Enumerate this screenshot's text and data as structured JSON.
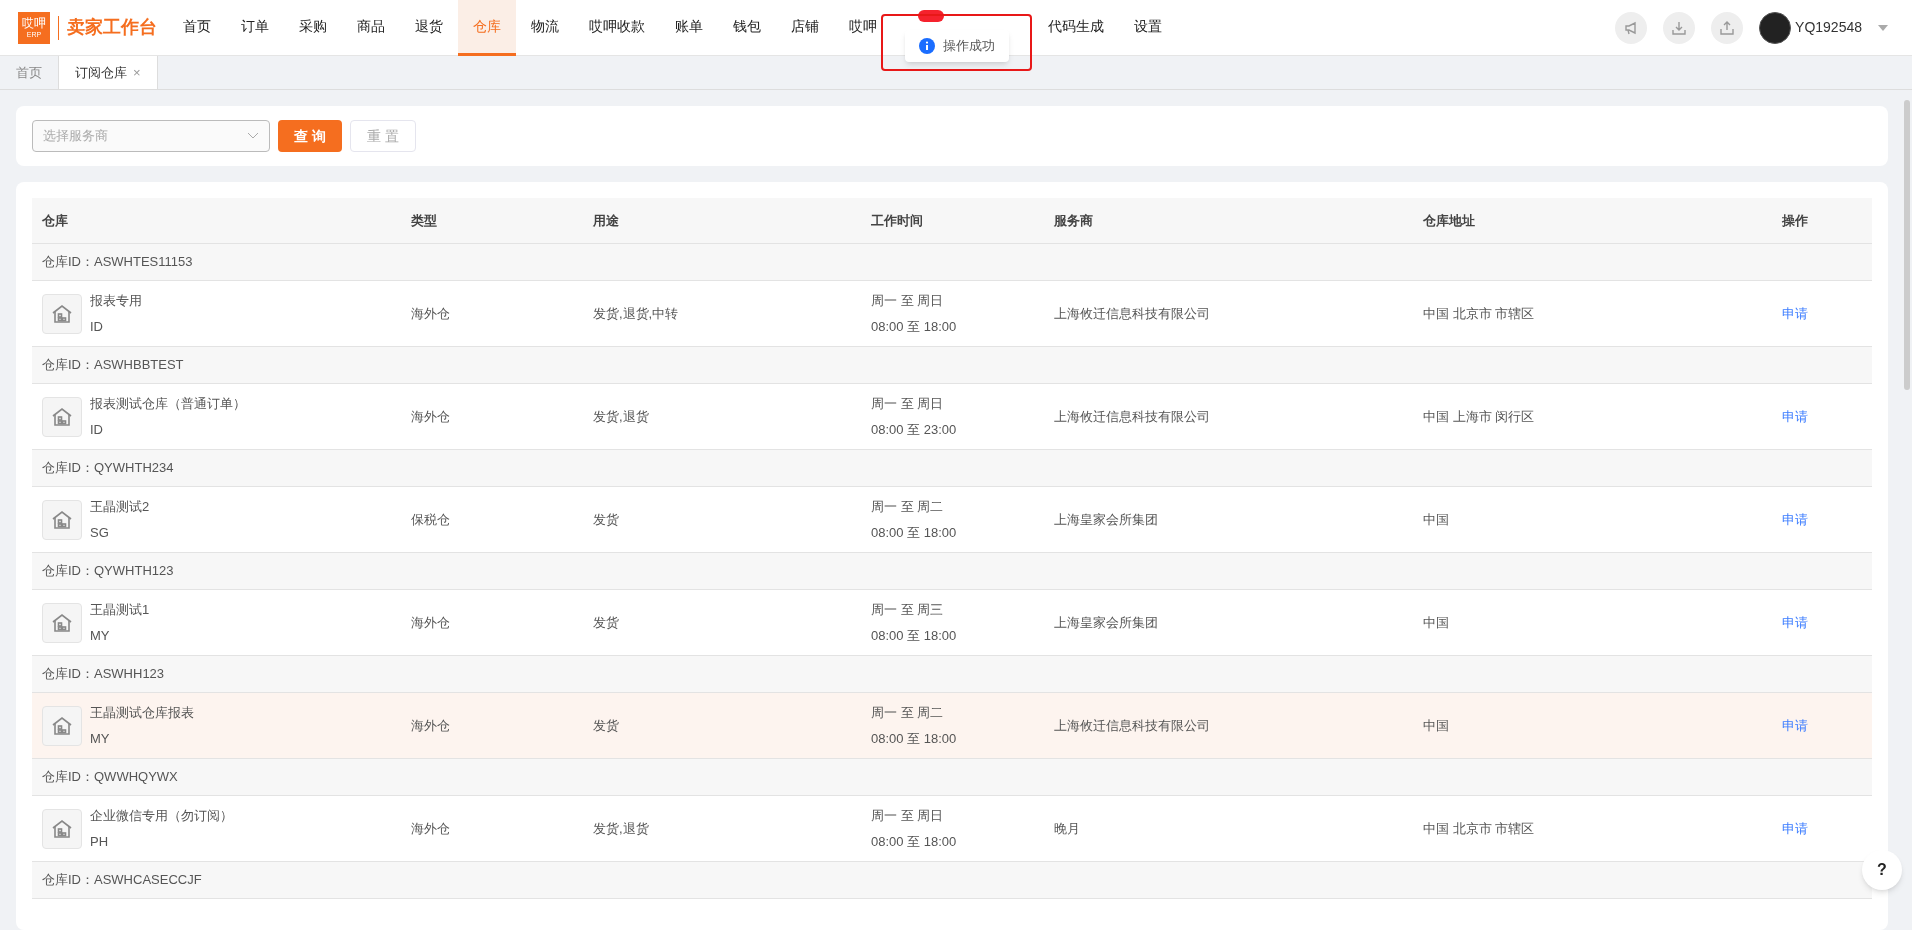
{
  "app": {
    "logo_top": "哎呷",
    "logo_bottom": "ERP",
    "title": "卖家工作台"
  },
  "nav": [
    {
      "label": "首页",
      "selected": false
    },
    {
      "label": "订单",
      "selected": false
    },
    {
      "label": "采购",
      "selected": false
    },
    {
      "label": "商品",
      "selected": false
    },
    {
      "label": "退货",
      "selected": false
    },
    {
      "label": "仓库",
      "selected": true
    },
    {
      "label": "物流",
      "selected": false
    },
    {
      "label": "哎呷收款",
      "selected": false
    },
    {
      "label": "账单",
      "selected": false
    },
    {
      "label": "钱包",
      "selected": false
    },
    {
      "label": "店铺",
      "selected": false
    },
    {
      "label": "哎呷",
      "selected": false
    },
    {
      "label": "代码生成",
      "selected": false
    },
    {
      "label": "设置",
      "selected": false
    }
  ],
  "toast": {
    "message": "操作成功"
  },
  "user": {
    "name": "YQ192548"
  },
  "page_tabs": [
    {
      "label": "首页",
      "selected": false,
      "closable": false
    },
    {
      "label": "订阅仓库",
      "selected": true,
      "closable": true
    }
  ],
  "close_glyph": "×",
  "filter": {
    "placeholder": "选择服务商",
    "query_button": "查 询",
    "reset_button": "重 置"
  },
  "table": {
    "columns": [
      "仓库",
      "类型",
      "用途",
      "工作时间",
      "服务商",
      "仓库地址",
      "操作"
    ],
    "groups": [
      {
        "id_label": "仓库ID：ASWHTES11153",
        "row": {
          "name": "报表专用",
          "code": "ID",
          "type": "海外仓",
          "usage": "发货,退货,中转",
          "days": "周一 至 周日",
          "hours": "08:00 至 18:00",
          "provider": "上海攸迁信息科技有限公司",
          "address": "中国 北京市 市辖区",
          "action": "申请",
          "highlighted": false
        }
      },
      {
        "id_label": "仓库ID：ASWHBBTEST",
        "row": {
          "name": "报表测试仓库（普通订单）",
          "code": "ID",
          "type": "海外仓",
          "usage": "发货,退货",
          "days": "周一 至 周日",
          "hours": "08:00 至 23:00",
          "provider": "上海攸迁信息科技有限公司",
          "address": "中国 上海市 闵行区",
          "action": "申请",
          "highlighted": false
        }
      },
      {
        "id_label": "仓库ID：QYWHTH234",
        "row": {
          "name": "王晶测试2",
          "code": "SG",
          "type": "保税仓",
          "usage": "发货",
          "days": "周一 至 周二",
          "hours": "08:00 至 18:00",
          "provider": "上海皇家会所集团",
          "address": "中国",
          "action": "申请",
          "highlighted": false
        }
      },
      {
        "id_label": "仓库ID：QYWHTH123",
        "row": {
          "name": "王晶测试1",
          "code": "MY",
          "type": "海外仓",
          "usage": "发货",
          "days": "周一 至 周三",
          "hours": "08:00 至 18:00",
          "provider": "上海皇家会所集团",
          "address": "中国",
          "action": "申请",
          "highlighted": false
        }
      },
      {
        "id_label": "仓库ID：ASWHH123",
        "row": {
          "name": "王晶测试仓库报表",
          "code": "MY",
          "type": "海外仓",
          "usage": "发货",
          "days": "周一 至 周二",
          "hours": "08:00 至 18:00",
          "provider": "上海攸迁信息科技有限公司",
          "address": "中国",
          "action": "申请",
          "highlighted": true
        }
      },
      {
        "id_label": "仓库ID：QWWHQYWX",
        "row": {
          "name": "企业微信专用（勿订阅）",
          "code": "PH",
          "type": "海外仓",
          "usage": "发货,退货",
          "days": "周一 至 周日",
          "hours": "08:00 至 18:00",
          "provider": "晚月",
          "address": "中国 北京市 市辖区",
          "action": "申请",
          "highlighted": false
        }
      },
      {
        "id_label": "仓库ID：ASWHCASECCJF"
      }
    ]
  },
  "help": {
    "label": "?"
  }
}
